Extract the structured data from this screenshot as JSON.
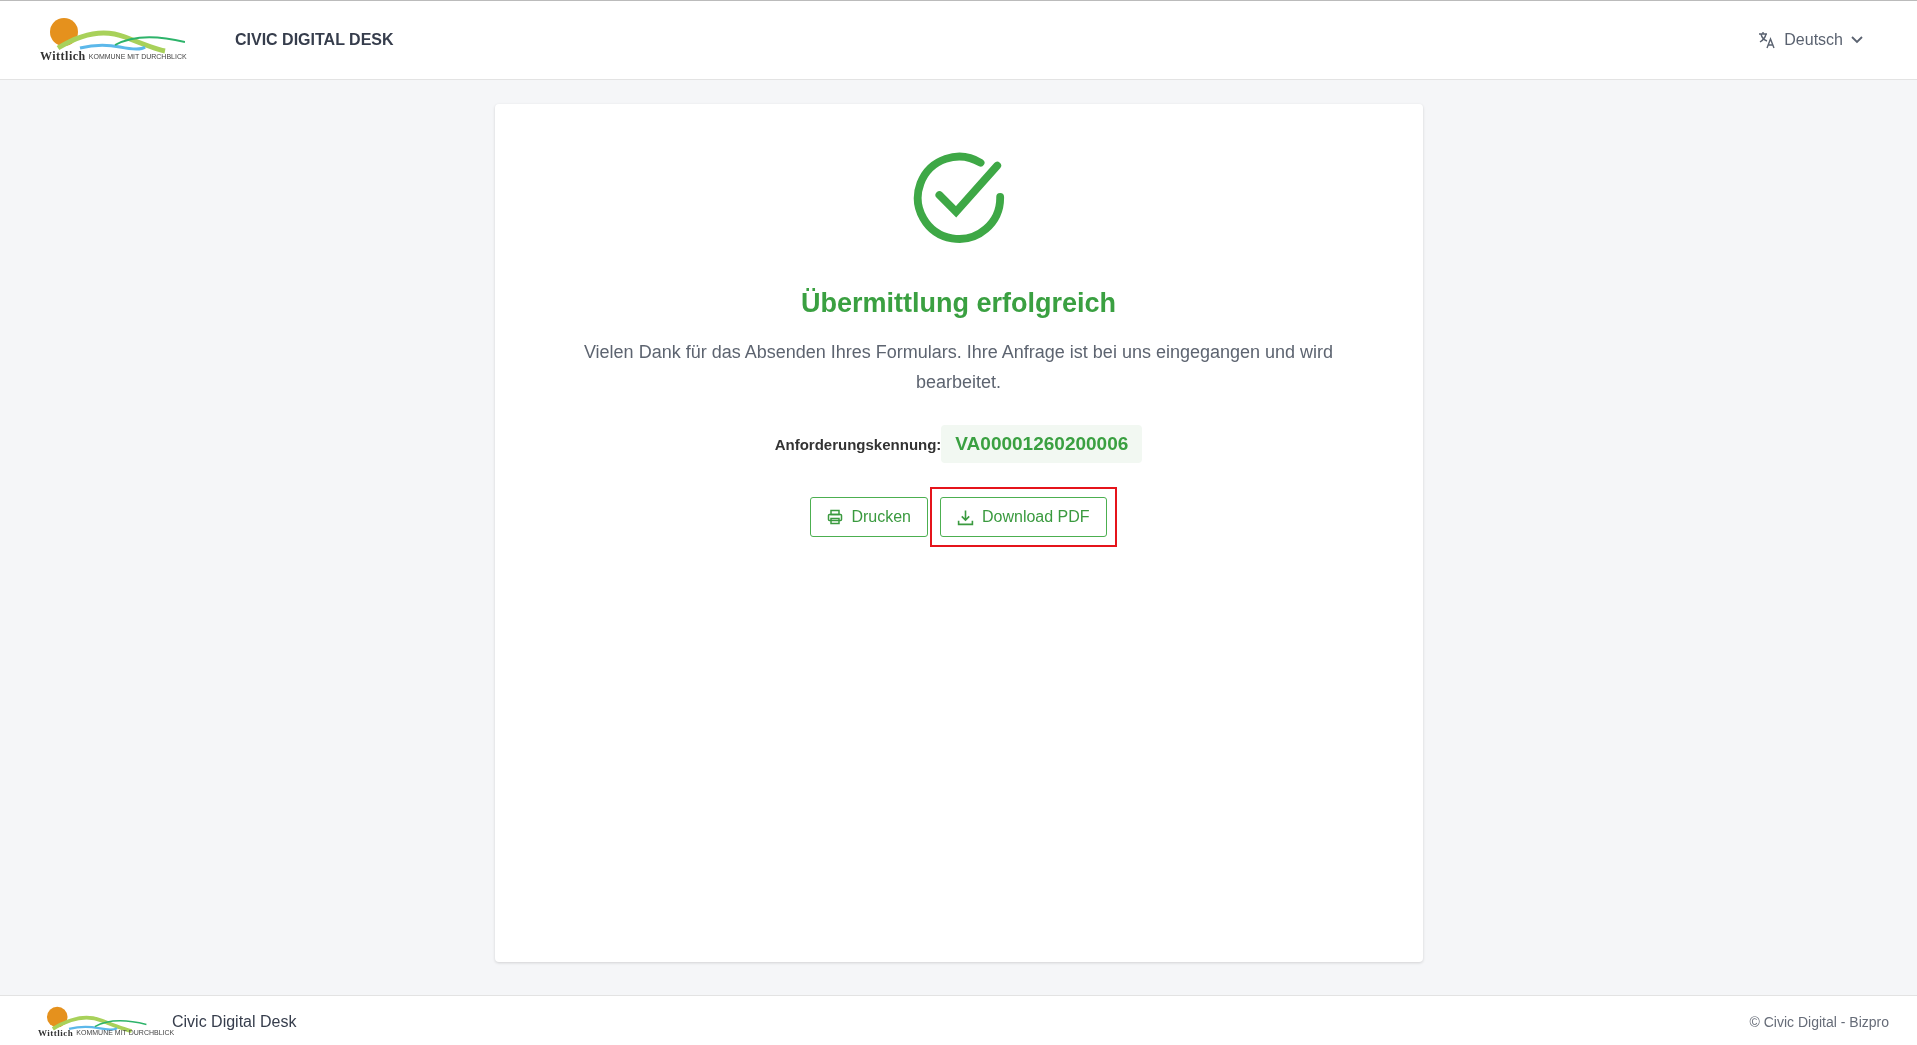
{
  "header": {
    "logo": {
      "name": "Wittlich",
      "tagline": "KOMMUNE MIT DURCHBLICK"
    },
    "title": "CIVIC DIGITAL DESK",
    "language": "Deutsch"
  },
  "result": {
    "heading": "Übermittlung erfolgreich",
    "message": "Vielen Dank für das Absenden Ihres Formulars. Ihre Anfrage ist bei uns eingegangen und wird bearbeitet.",
    "id_label": "Anforderungskennung:",
    "id_value": "VA00001260200006",
    "buttons": [
      {
        "kind": "print",
        "label": "Drucken",
        "highlighted": false
      },
      {
        "kind": "download",
        "label": "Download PDF",
        "highlighted": true
      }
    ]
  },
  "footer": {
    "logo": {
      "name": "Wittlich",
      "tagline": "KOMMUNE MIT DURCHBLICK"
    },
    "title": "Civic Digital Desk",
    "copyright": "© Civic Digital - Bizpro"
  }
}
